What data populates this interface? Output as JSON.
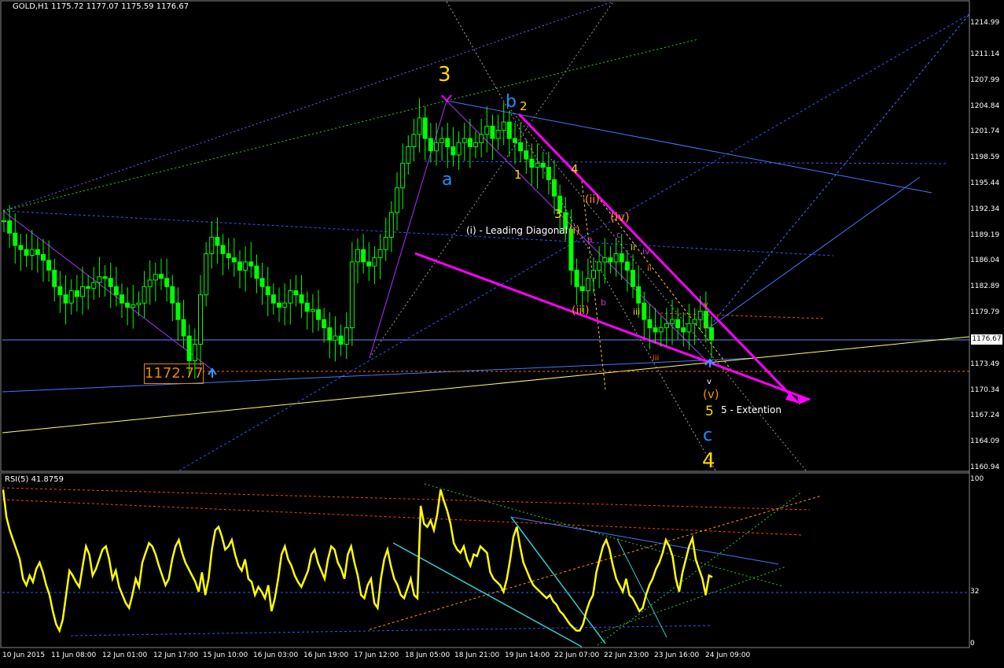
{
  "window": {
    "title": "GOLD,H1  1175.72 1177.07 1175.59 1176.67",
    "rsi_title": "RSI(5) 41.8759"
  },
  "current_price": "1176.67",
  "low_marker": "1172.77",
  "colors": {
    "background": "#000000",
    "bull_candle": "#00ff00",
    "bear_candle": "#00ff00",
    "rsi_line": "#ffff00",
    "magenta": "#ff00ff",
    "wave_yellow": "#ffd700",
    "wave_blue": "#1e90ff",
    "wave_orange": "#ff8c00"
  },
  "chart_data": [
    {
      "type": "candlestick",
      "title": "GOLD,H1  1175.72 1177.07 1175.59 1176.67",
      "ylim": [
        1160.94,
        1216.11
      ],
      "y_ticks": [
        "1214.99",
        "1211.14",
        "1207.99",
        "1204.84",
        "1201.74",
        "1198.59",
        "1195.44",
        "1192.34",
        "1189.19",
        "1186.04",
        "1182.89",
        "1179.79",
        "1176.67",
        "1173.49",
        "1170.34",
        "1167.24",
        "1164.09",
        "1160.94"
      ],
      "x_ticks": [
        "10 Jun 2015",
        "11 Jun 08:00",
        "12 Jun 01:00",
        "12 Jun 17:00",
        "15 Jun 10:00",
        "16 Jun 03:00",
        "16 Jun 19:00",
        "17 Jun 12:00",
        "18 Jun 05:00",
        "18 Jun 21:00",
        "19 Jun 14:00",
        "22 Jun 07:00",
        "22 Jun 23:00",
        "23 Jun 16:00",
        "24 Jun 09:00"
      ],
      "close_path": [
        1191.0,
        1189.5,
        1188.0,
        1187.5,
        1186.8,
        1187.5,
        1186.9,
        1186.2,
        1185.0,
        1183.0,
        1182.0,
        1181.0,
        1182.5,
        1181.8,
        1183.0,
        1182.8,
        1183.5,
        1184.2,
        1184.0,
        1183.0,
        1182.0,
        1181.0,
        1180.5,
        1180.8,
        1181.0,
        1183.0,
        1183.8,
        1184.5,
        1184.0,
        1183.0,
        1181.0,
        1179.0,
        1177.0,
        1174.0,
        1176.0,
        1182.0,
        1187.0,
        1189.0,
        1188.0,
        1187.0,
        1186.5,
        1186.0,
        1185.0,
        1186.0,
        1185.5,
        1184.0,
        1183.0,
        1182.0,
        1181.0,
        1180.5,
        1181.0,
        1182.5,
        1182.0,
        1181.0,
        1180.0,
        1180.2,
        1179.0,
        1178.0,
        1176.5,
        1177.0,
        1176.0,
        1178.0,
        1186.0,
        1187.5,
        1186.0,
        1185.5,
        1186.5,
        1187.5,
        1189.0,
        1192.0,
        1195.0,
        1198.0,
        1200.0,
        1201.5,
        1203.5,
        1201.0,
        1199.5,
        1200.5,
        1201.0,
        1200.0,
        1199.0,
        1200.5,
        1201.0,
        1200.0,
        1200.5,
        1201.5,
        1202.5,
        1201.0,
        1202.0,
        1203.0,
        1201.0,
        1200.5,
        1199.5,
        1198.5,
        1197.5,
        1198.0,
        1197.5,
        1196.0,
        1194.0,
        1192.0,
        1190.0,
        1185.0,
        1183.0,
        1182.5,
        1184.0,
        1185.0,
        1186.0,
        1186.5,
        1186.0,
        1187.0,
        1186.0,
        1185.0,
        1183.0,
        1181.0,
        1179.0,
        1178.0,
        1177.5,
        1178.0,
        1178.5,
        1179.0,
        1178.0,
        1177.5,
        1178.5,
        1179.0,
        1180.0,
        1178.0,
        1176.5
      ]
    },
    {
      "type": "line",
      "title": "RSI(5) 41.8759",
      "ylim": [
        0,
        100
      ],
      "y_ticks": [
        "100",
        "32",
        "0"
      ],
      "series": [
        {
          "values": [
            95,
            78,
            70,
            64,
            58,
            52,
            40,
            36,
            42,
            38,
            46,
            50,
            44,
            36,
            30,
            20,
            12,
            8,
            15,
            30,
            45,
            42,
            38,
            35,
            48,
            60,
            55,
            42,
            46,
            52,
            58,
            60,
            52,
            40,
            45,
            35,
            30,
            25,
            22,
            30,
            40,
            35,
            50,
            56,
            62,
            60,
            55,
            48,
            42,
            36,
            40,
            52,
            60,
            64,
            56,
            50,
            46,
            42,
            38,
            32,
            44,
            30,
            40,
            58,
            70,
            72,
            66,
            58,
            60,
            64,
            55,
            48,
            45,
            52,
            40,
            38,
            30,
            35,
            32,
            28,
            36,
            20,
            28,
            40,
            55,
            60,
            52,
            48,
            42,
            38,
            35,
            40,
            45,
            55,
            58,
            50,
            45,
            40,
            52,
            60,
            58,
            50,
            46,
            40,
            55,
            60,
            50,
            42,
            30,
            28,
            36,
            40,
            25,
            22,
            40,
            52,
            58,
            48,
            40,
            36,
            30,
            28,
            34,
            40,
            30,
            28,
            85,
            74,
            72,
            76,
            70,
            80,
            95,
            88,
            82,
            74,
            62,
            58,
            56,
            60,
            52,
            48,
            55,
            54,
            60,
            58,
            56,
            44,
            40,
            38,
            36,
            32,
            40,
            52,
            66,
            72,
            60,
            50,
            45,
            40,
            36,
            34,
            32,
            30,
            28,
            30,
            26,
            24,
            20,
            18,
            15,
            12,
            10,
            8,
            8,
            12,
            20,
            26,
            30,
            44,
            52,
            60,
            64,
            58,
            48,
            40,
            36,
            32,
            40,
            30,
            28,
            24,
            20,
            22,
            30,
            36,
            40,
            46,
            50,
            56,
            64,
            60,
            54,
            40,
            32,
            44,
            52,
            60,
            65,
            52,
            46,
            40,
            30,
            42,
            41
          ]
        }
      ]
    }
  ],
  "annotations": {
    "wave_3": "3",
    "wave_a": "a",
    "wave_b": "b",
    "wave_2": "2",
    "wave_1": "1",
    "wave_4_small": "4",
    "wave_3_small": "3",
    "wave_ii": "(ii)",
    "wave_iv": "(iv)",
    "wave_i": "(i)",
    "leading_diagonal": "(i) - Leading Diagonal",
    "wave_iii": "(iii)",
    "wave_v": "(v)",
    "wave_5": "5",
    "extention": "5 - Extention",
    "wave_c": "c",
    "wave_4": "4",
    "sub_a": "a",
    "sub_b": "b",
    "sub_c": "c",
    "sub_iii": "iii",
    "sub_ii": "ii",
    "sub_iv": "iv",
    "sub_v": "v",
    "sub_iii_small": "iii",
    "sub_ii_small": "ii",
    "sub_v_small": "v",
    "sub_i_small": "i"
  }
}
